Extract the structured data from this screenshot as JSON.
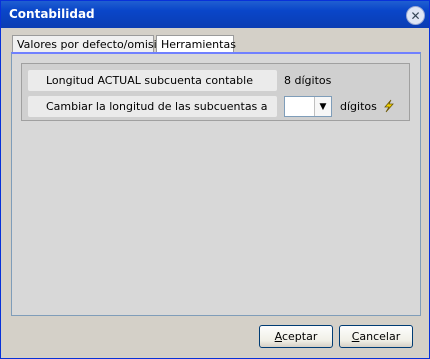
{
  "window": {
    "title": "Contabilidad"
  },
  "tabs": [
    {
      "label": "Valores por defecto/omisión"
    },
    {
      "label": "Herramientas"
    }
  ],
  "tools": {
    "current_length_label": "Longitud ACTUAL subcuenta contable",
    "current_length_value": "8 dígitos",
    "change_length_label": "Cambiar la longitud de las subcuentas a",
    "change_length_value": "",
    "change_length_unit": "dígitos"
  },
  "buttons": {
    "accept_label_u": "A",
    "accept_label_rest": "ceptar",
    "cancel_label_u": "C",
    "cancel_label_rest": "ancelar"
  }
}
